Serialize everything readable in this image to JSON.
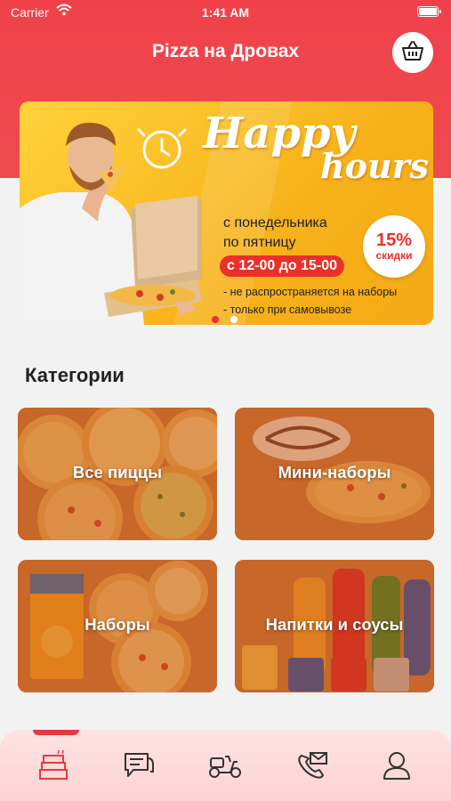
{
  "status_bar": {
    "carrier": "Carrier",
    "time": "1:41 AM"
  },
  "header": {
    "title": "Pizza на Дровах",
    "cart_icon": "basket-icon"
  },
  "banner": {
    "headline_line1": "Happy",
    "headline_line2": "hours",
    "days_line1": "с понедельника",
    "days_line2": "по пятницу",
    "hours": "с 12-00 до 15-00",
    "discount_percent": "15%",
    "discount_label": "скидки",
    "note1": "- не распространяется на наборы",
    "note2": "- только при самовывозе",
    "slides": 2,
    "active_slide": 1
  },
  "categories": {
    "title": "Категории",
    "items": [
      {
        "label": "Все пиццы"
      },
      {
        "label": "Мини-наборы"
      },
      {
        "label": "Наборы"
      },
      {
        "label": "Напитки и соусы"
      }
    ]
  },
  "tabbar": {
    "items": [
      {
        "icon": "pizza-boxes-icon",
        "active": true
      },
      {
        "icon": "chat-icon",
        "active": false
      },
      {
        "icon": "scooter-icon",
        "active": false
      },
      {
        "icon": "phone-icon",
        "active": false
      },
      {
        "icon": "profile-icon",
        "active": false
      }
    ]
  },
  "colors": {
    "brand": "#ee4b4f",
    "accent": "#e8312a",
    "banner": "#f7b21a"
  }
}
